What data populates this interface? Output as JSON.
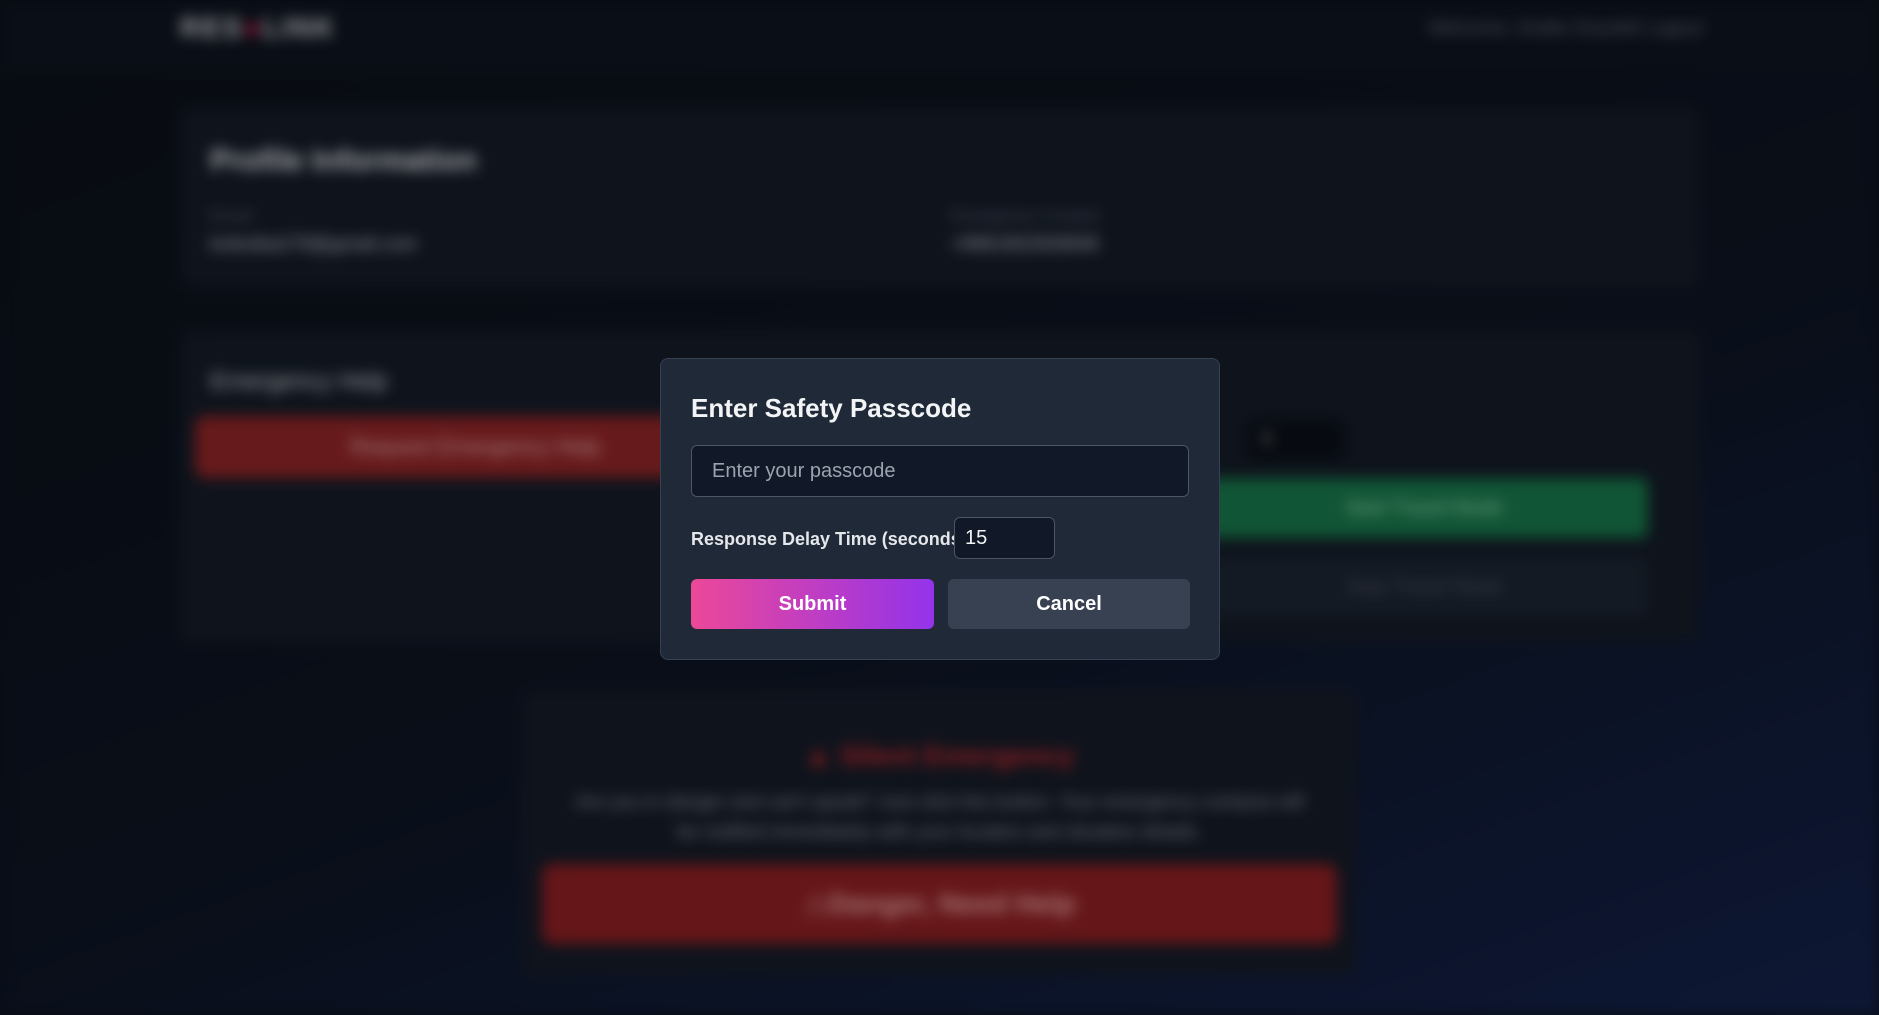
{
  "background": {
    "logo_left": "RES",
    "logo_right": "LINK",
    "nav": {
      "welcome": "Welcome, Dodla Sriyuktti",
      "logout": "Logout"
    },
    "profile": {
      "title": "Profile Information",
      "email_label": "Email",
      "email_value": "kolesiba278@gmail.com",
      "contact_label": "Emergency Contact",
      "contact_value": "+9981902930848"
    },
    "help": {
      "title": "Emergency Help",
      "request_button": "Request Emergency Help",
      "delay_value": "5",
      "start_travel": "Start Travel Mode",
      "stop_travel": "Stop Travel Mode"
    },
    "silent": {
      "title": "Silent Emergency",
      "description": "Are you in danger and can't speak? Just click this button. Your emergency contacts will be notified immediately with your location and situation details.",
      "button": "Danger, Need Help"
    }
  },
  "modal": {
    "title": "Enter Safety Passcode",
    "passcode_placeholder": "Enter your passcode",
    "passcode_value": "",
    "delay_label": "Response Delay Time (seconds):",
    "delay_value": "15",
    "submit_label": "Submit",
    "cancel_label": "Cancel"
  },
  "colors": {
    "accent_gradient_start": "#ec4899",
    "accent_gradient_end": "#9333ea",
    "modal_bg": "#1f2937",
    "danger": "#c3272d"
  }
}
